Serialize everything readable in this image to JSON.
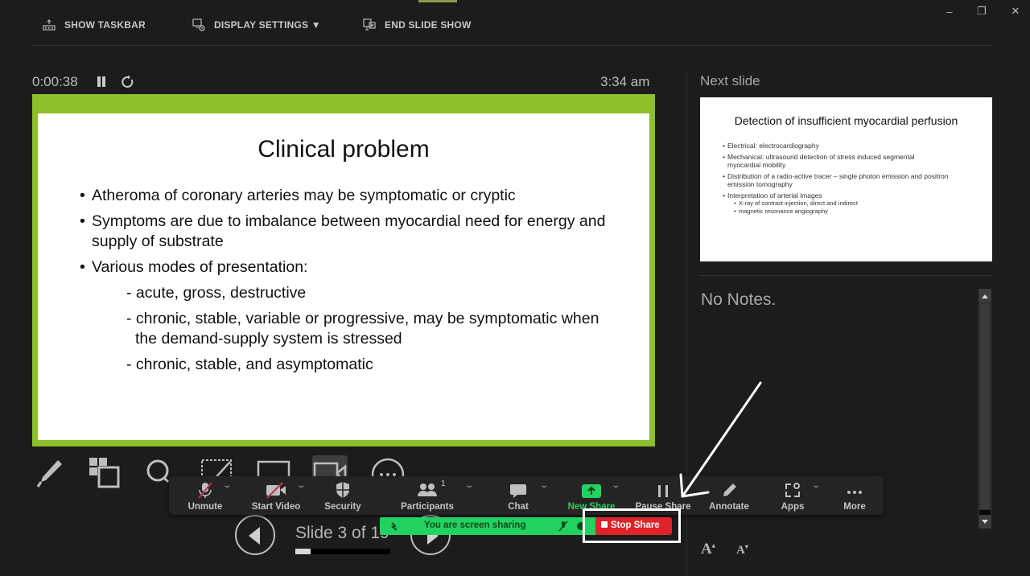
{
  "topbar": {
    "show_taskbar": "SHOW TASKBAR",
    "display_settings": "DISPLAY SETTINGS ▼",
    "end_slide_show": "END SLIDE SHOW",
    "minimize": "–",
    "restore": "❐",
    "close": "✕"
  },
  "presenter": {
    "timer": "0:00:38",
    "clock": "3:34 am",
    "next_slide_label": "Next slide",
    "notes": "No Notes.",
    "slide_counter": "Slide 3 of 19",
    "progress_fraction": 0.158
  },
  "current_slide": {
    "title": "Clinical problem",
    "bullets": [
      "Atheroma of coronary arteries may be symptomatic or cryptic",
      "Symptoms are due to imbalance between myocardial need for energy and supply of substrate",
      "Various modes of presentation:"
    ],
    "sub_items": [
      "- acute, gross, destructive",
      "- chronic, stable, variable or progressive, may be symptomatic when the demand-supply system is stressed",
      "- chronic, stable, and asymptomatic"
    ]
  },
  "next_slide": {
    "title": "Detection of insufficient myocardial perfusion",
    "bullets": [
      "Electrical: electrocardiography",
      "Mechanical: ultrasound detection of stress induced segmental myocardial mobility",
      "Distribution of a radio-active tracer – single photon emission and positron emission tomography",
      "Interpretation of arterial images"
    ],
    "sub_items": [
      "X-ray of contrast injection, direct and indirect",
      "magnetic resonance angiography"
    ]
  },
  "zoom_toolbar": {
    "unmute": "Unmute",
    "start_video": "Start Video",
    "security": "Security",
    "participants": "Participants",
    "participants_count": "1",
    "chat": "Chat",
    "new_share": "New Share",
    "pause_share": "Pause Share",
    "annotate": "Annotate",
    "apps": "Apps",
    "more": "More"
  },
  "sharing": {
    "banner_text": "You are screen sharing",
    "stop_share": "Stop Share"
  },
  "colors": {
    "slide_border": "#8dc02a",
    "share_green": "#23d160",
    "stop_red": "#e0232b"
  }
}
